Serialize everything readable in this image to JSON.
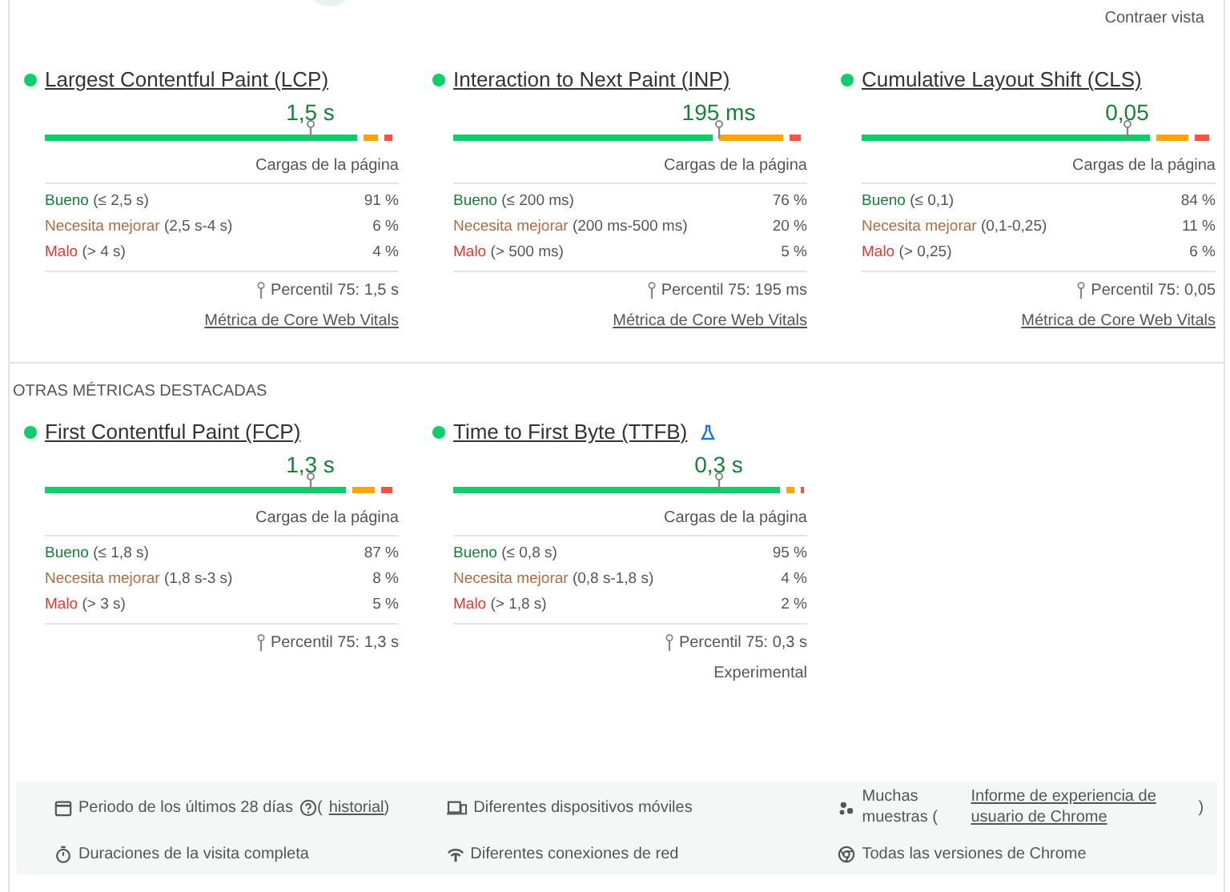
{
  "collapse_link": "Contraer vista",
  "core_metrics": [
    {
      "title": "Largest Contentful Paint (LCP)",
      "value": "1,5 s",
      "caption": "Cargas de la página",
      "rows": [
        {
          "kind": "good",
          "label": "Bueno",
          "range": "(≤ 2,5 s)",
          "percent": "91 %"
        },
        {
          "kind": "ni",
          "label": "Necesita mejorar",
          "range": "(2,5 s-4 s)",
          "percent": "6 %"
        },
        {
          "kind": "poor",
          "label": "Malo",
          "range": "(> 4 s)",
          "percent": "4 %"
        }
      ],
      "percentile": "Percentil 75: 1,5 s",
      "footer_link": "Métrica de Core Web Vitals"
    },
    {
      "title": "Interaction to Next Paint (INP)",
      "value": "195 ms",
      "caption": "Cargas de la página",
      "rows": [
        {
          "kind": "good",
          "label": "Bueno",
          "range": "(≤ 200 ms)",
          "percent": "76 %"
        },
        {
          "kind": "ni",
          "label": "Necesita mejorar",
          "range": "(200 ms-500 ms)",
          "percent": "20 %"
        },
        {
          "kind": "poor",
          "label": "Malo",
          "range": "(> 500 ms)",
          "percent": "5 %"
        }
      ],
      "percentile": "Percentil 75: 195 ms",
      "footer_link": "Métrica de Core Web Vitals"
    },
    {
      "title": "Cumulative Layout Shift (CLS)",
      "value": "0,05",
      "caption": "Cargas de la página",
      "rows": [
        {
          "kind": "good",
          "label": "Bueno",
          "range": "(≤ 0,1)",
          "percent": "84 %"
        },
        {
          "kind": "ni",
          "label": "Necesita mejorar",
          "range": "(0,1-0,25)",
          "percent": "11 %"
        },
        {
          "kind": "poor",
          "label": "Malo",
          "range": "(> 0,25)",
          "percent": "6 %"
        }
      ],
      "percentile": "Percentil 75: 0,05",
      "footer_link": "Métrica de Core Web Vitals"
    }
  ],
  "other_heading": "OTRAS MÉTRICAS DESTACADAS",
  "other_metrics": [
    {
      "title": "First Contentful Paint (FCP)",
      "value": "1,3 s",
      "caption": "Cargas de la página",
      "rows": [
        {
          "kind": "good",
          "label": "Bueno",
          "range": "(≤ 1,8 s)",
          "percent": "87 %"
        },
        {
          "kind": "ni",
          "label": "Necesita mejorar",
          "range": "(1,8 s-3 s)",
          "percent": "8 %"
        },
        {
          "kind": "poor",
          "label": "Malo",
          "range": "(> 3 s)",
          "percent": "5 %"
        }
      ],
      "percentile": "Percentil 75: 1,3 s"
    },
    {
      "title": "Time to First Byte (TTFB)",
      "experimental_icon": true,
      "value": "0,3 s",
      "caption": "Cargas de la página",
      "rows": [
        {
          "kind": "good",
          "label": "Bueno",
          "range": "(≤ 0,8 s)",
          "percent": "95 %"
        },
        {
          "kind": "ni",
          "label": "Necesita mejorar",
          "range": "(0,8 s-1,8 s)",
          "percent": "4 %"
        },
        {
          "kind": "poor",
          "label": "Malo",
          "range": "(> 1,8 s)",
          "percent": "2 %"
        }
      ],
      "percentile": "Percentil 75: 0,3 s",
      "note": "Experimental"
    }
  ],
  "footer": {
    "period": "Periodo de los últimos 28 días",
    "period_link_open": "(",
    "period_link": "historial",
    "period_link_close": ")",
    "devices": "Diferentes dispositivos móviles",
    "samples_prefix": "Muchas muestras (",
    "samples_link": "Informe de experiencia de usuario de Chrome",
    "samples_suffix": ")",
    "durations": "Duraciones de la visita completa",
    "connections": "Diferentes conexiones de red",
    "versions": "Todas las versiones de Chrome"
  }
}
